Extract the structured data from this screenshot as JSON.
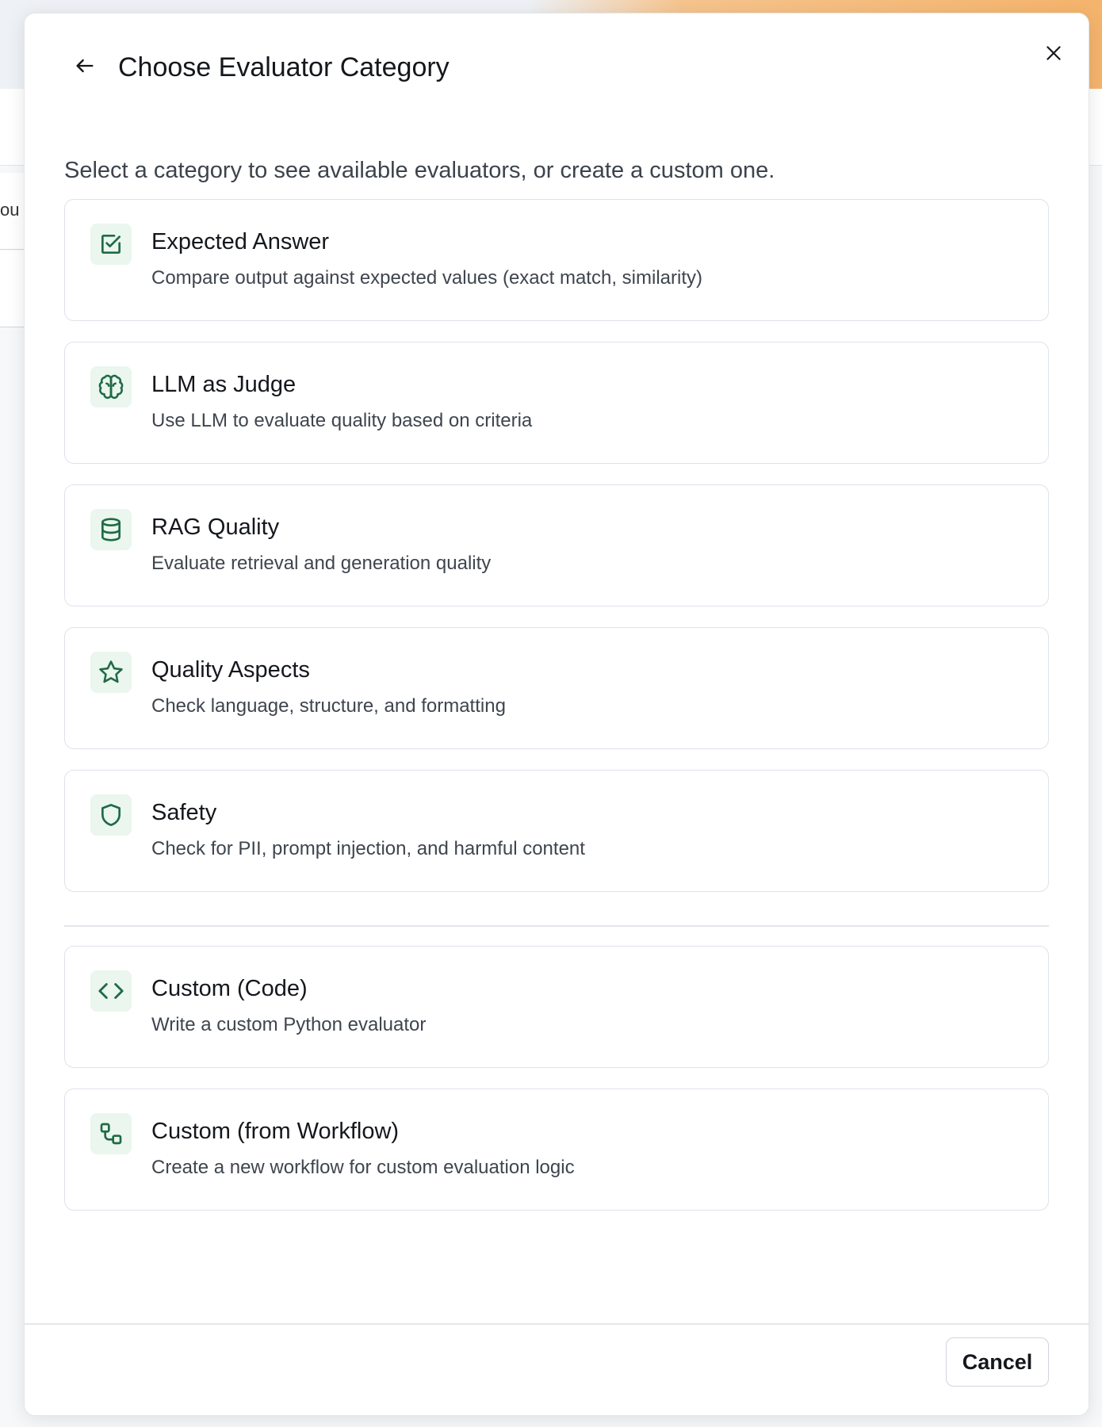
{
  "background": {
    "partial_text": "ou"
  },
  "dialog": {
    "title": "Choose Evaluator Category",
    "subtitle": "Select a category to see available evaluators, or create a custom one.",
    "back_icon": "arrow-left-icon",
    "close_icon": "close-icon",
    "categories": [
      {
        "icon": "check-square-icon",
        "title": "Expected Answer",
        "description": "Compare output against expected values (exact match, similarity)"
      },
      {
        "icon": "brain-icon",
        "title": "LLM as Judge",
        "description": "Use LLM to evaluate quality based on criteria"
      },
      {
        "icon": "database-icon",
        "title": "RAG Quality",
        "description": "Evaluate retrieval and generation quality"
      },
      {
        "icon": "star-icon",
        "title": "Quality Aspects",
        "description": "Check language, structure, and formatting"
      },
      {
        "icon": "shield-icon",
        "title": "Safety",
        "description": "Check for PII, prompt injection, and harmful content"
      }
    ],
    "custom": [
      {
        "icon": "code-icon",
        "title": "Custom (Code)",
        "description": "Write a custom Python evaluator"
      },
      {
        "icon": "workflow-icon",
        "title": "Custom (from Workflow)",
        "description": "Create a new workflow for custom evaluation logic"
      }
    ],
    "cancel_label": "Cancel"
  },
  "colors": {
    "icon_green": "#1f6b45",
    "icon_bg": "#eaf6ee",
    "accent_orange": "#f5b46c"
  }
}
